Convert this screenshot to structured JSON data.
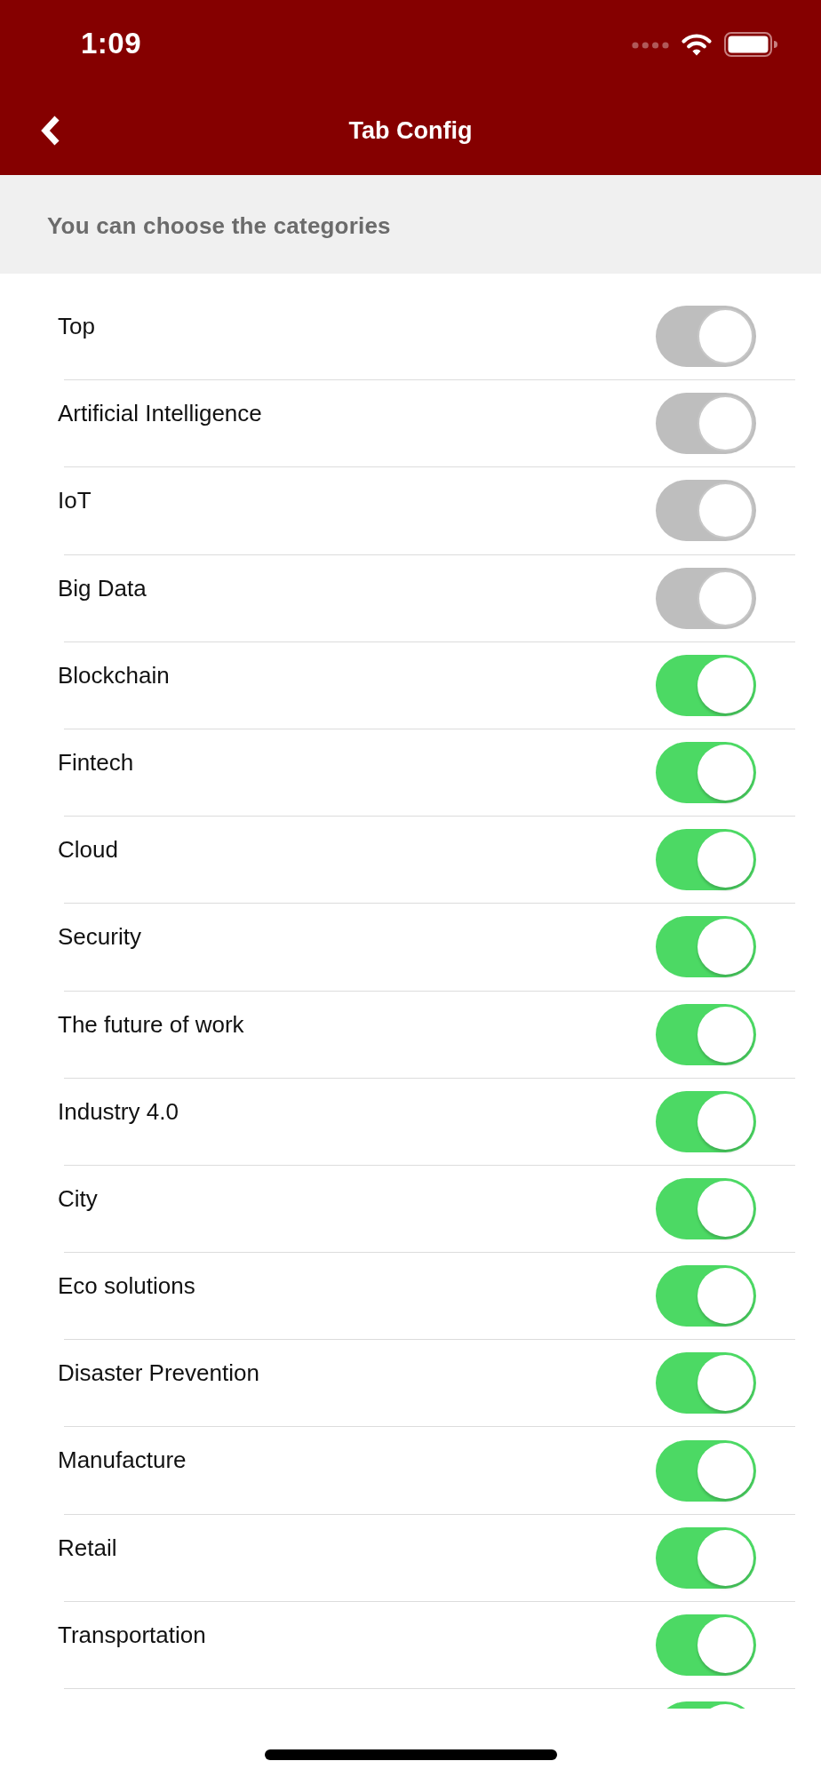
{
  "status_bar": {
    "time": "1:09"
  },
  "nav_bar": {
    "title": "Tab Config"
  },
  "section_header": {
    "text": "You can choose the categories"
  },
  "categories": [
    {
      "label": "Top",
      "on": true,
      "disabled": true
    },
    {
      "label": "Artificial Intelligence",
      "on": true,
      "disabled": true
    },
    {
      "label": "IoT",
      "on": true,
      "disabled": true
    },
    {
      "label": "Big Data",
      "on": true,
      "disabled": true
    },
    {
      "label": "Blockchain",
      "on": true,
      "disabled": false
    },
    {
      "label": "Fintech",
      "on": true,
      "disabled": false
    },
    {
      "label": "Cloud",
      "on": true,
      "disabled": false
    },
    {
      "label": "Security",
      "on": true,
      "disabled": false
    },
    {
      "label": "The future of work",
      "on": true,
      "disabled": false
    },
    {
      "label": "Industry 4.0",
      "on": true,
      "disabled": false
    },
    {
      "label": "City",
      "on": true,
      "disabled": false
    },
    {
      "label": "Eco solutions",
      "on": true,
      "disabled": false
    },
    {
      "label": "Disaster Prevention",
      "on": true,
      "disabled": false
    },
    {
      "label": "Manufacture",
      "on": true,
      "disabled": false
    },
    {
      "label": "Retail",
      "on": true,
      "disabled": false
    },
    {
      "label": "Transportation",
      "on": true,
      "disabled": false
    },
    {
      "on": true,
      "disabled": false
    }
  ]
}
